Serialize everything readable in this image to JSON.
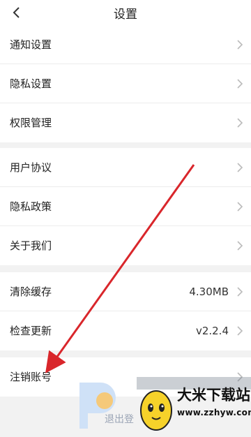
{
  "header": {
    "title": "设置",
    "back_icon": "chevron-left-icon"
  },
  "groups": [
    {
      "items": [
        {
          "label": "通知设置"
        },
        {
          "label": "隐私设置"
        },
        {
          "label": "权限管理"
        }
      ]
    },
    {
      "items": [
        {
          "label": "用户协议"
        },
        {
          "label": "隐私政策"
        },
        {
          "label": "关于我们"
        }
      ]
    },
    {
      "items": [
        {
          "label": "清除缓存",
          "value": "4.30MB"
        },
        {
          "label": "检查更新",
          "value": "v2.2.4"
        }
      ]
    },
    {
      "items": [
        {
          "label": "注销账号"
        }
      ]
    }
  ],
  "logout": {
    "label": "退出登"
  },
  "watermark": {
    "title": "大米下载站",
    "url": "www.zzhyw.com"
  },
  "colors": {
    "arrow": "#d9262b",
    "divider": "#ececec",
    "background": "#f2f2f2"
  }
}
